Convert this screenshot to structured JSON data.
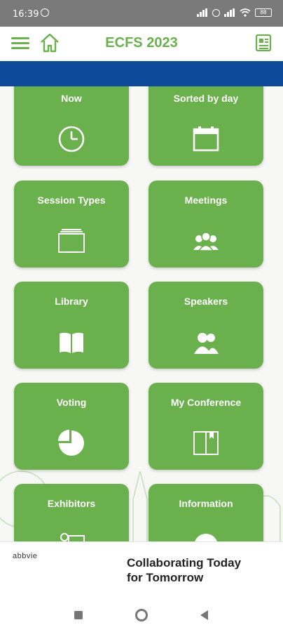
{
  "status_bar": {
    "time": "16:39",
    "battery": "88"
  },
  "app_bar": {
    "title": "ECFS 2023"
  },
  "tiles": [
    {
      "label": "Now",
      "icon": "clock-icon"
    },
    {
      "label": "Sorted by day",
      "icon": "calendar-icon"
    },
    {
      "label": "Session Types",
      "icon": "folders-icon"
    },
    {
      "label": "Meetings",
      "icon": "group-icon"
    },
    {
      "label": "Library",
      "icon": "book-icon"
    },
    {
      "label": "Speakers",
      "icon": "speakers-icon"
    },
    {
      "label": "Voting",
      "icon": "pie-chart-icon"
    },
    {
      "label": "My Conference",
      "icon": "bookmark-book-icon"
    },
    {
      "label": "Exhibitors",
      "icon": "exhibitor-icon"
    },
    {
      "label": "Information",
      "icon": "info-icon"
    }
  ],
  "ad": {
    "brand": "abbvie",
    "line1": "Collaborating Today",
    "line2": "for Tomorrow"
  },
  "colors": {
    "accent": "#6ab04c",
    "banner": "#0d4a9a",
    "statusbar": "#7a7a7a"
  }
}
